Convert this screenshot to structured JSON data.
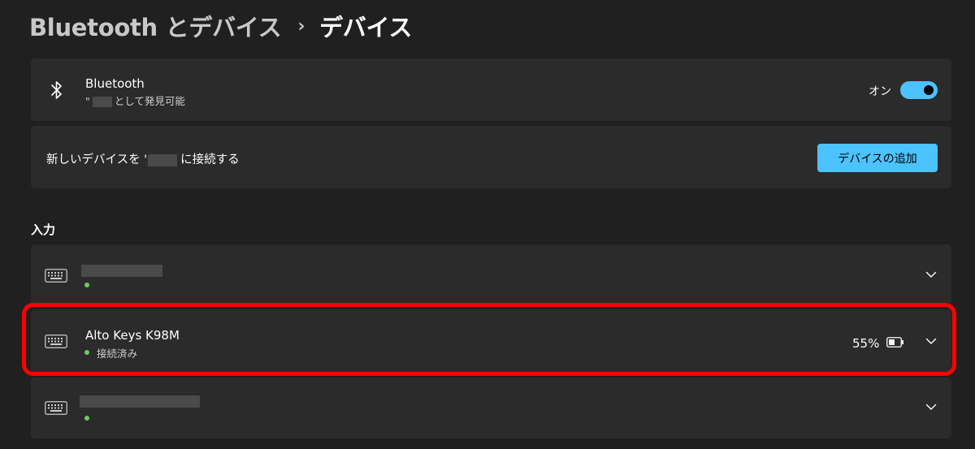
{
  "breadcrumb": {
    "parent": "Bluetooth とデバイス",
    "separator": "›",
    "current": "デバイス"
  },
  "bluetooth": {
    "icon": "bluetooth-icon",
    "title": "Bluetooth",
    "subtitle_prefix": "\"",
    "subtitle_suffix": "として発見可能",
    "toggle_label": "オン",
    "toggle_on": true
  },
  "add_device": {
    "label_prefix": "新しいデバイスを '",
    "label_suffix": "に接続する",
    "button_label": "デバイスの追加"
  },
  "input_section": {
    "heading": "入力",
    "devices": [
      {
        "icon": "keyboard-icon",
        "name": "",
        "status": "",
        "battery": "",
        "name_redacted": true
      },
      {
        "icon": "keyboard-icon",
        "name": "Alto Keys K98M",
        "status": "接続済み",
        "battery": "55%",
        "highlighted": true
      },
      {
        "icon": "keyboard-icon",
        "name": "",
        "status": "",
        "battery": "",
        "name_redacted": true
      }
    ]
  },
  "colors": {
    "background": "#202020",
    "card": "#2b2b2b",
    "accent": "#4cc2ff",
    "connected_dot": "#6ccb5f",
    "highlight": "#ff0000"
  }
}
